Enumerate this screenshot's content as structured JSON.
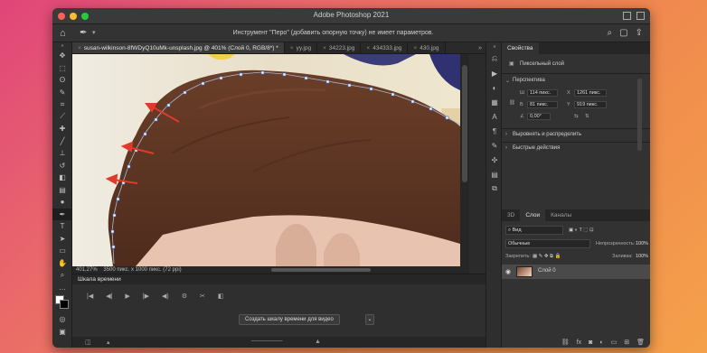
{
  "window": {
    "title": "Adobe Photoshop 2021",
    "traffic_lights": [
      "#ff5f57",
      "#febc2e",
      "#28c840"
    ]
  },
  "options_bar": {
    "hint": "Инструмент \"Перо\" (добавить опорную точку) не имеет параметров.",
    "home_icon": "home-icon",
    "tool_icon": "pen-tool-icon"
  },
  "doc_tabs": [
    {
      "label": "susan-wilkinson-8fWDyQ10uMk-unsplash.jpg @ 401% (Слой 0, RGB/8*) *",
      "active": true
    },
    {
      "label": "yy.jpg",
      "active": false
    },
    {
      "label": "34223.jpg",
      "active": false
    },
    {
      "label": "434333.jpg",
      "active": false
    },
    {
      "label": "430.jpg",
      "active": false
    }
  ],
  "tabs_more": "»",
  "status": {
    "zoom": "401,27%",
    "info": "3500 пикс. x 1000 пикс. (72 ppi)"
  },
  "properties": {
    "tab_label": "Свойства",
    "layer_type": "Пиксельный слой",
    "transform_title": "Перспектива",
    "w_label": "Ш",
    "w_value": "114 пикс.",
    "h_label": "В",
    "h_value": "81 пикс.",
    "x_label": "X",
    "x_value": "1261 пикс.",
    "y_label": "Y",
    "y_value": "919 пикс.",
    "angle_value": "0,00°",
    "align_title": "Выровнять и распределить",
    "quick_title": "Быстрые действия"
  },
  "layers": {
    "tabs": [
      "3D",
      "Слои",
      "Каналы"
    ],
    "active_tab": "Слои",
    "filter_label": "Вид",
    "blend_mode": "Обычные",
    "opacity_label": "Непрозрачность:",
    "opacity_value": "100%",
    "lock_label": "Закрепить:",
    "fill_label": "Заливка:",
    "fill_value": "100%",
    "items": [
      {
        "name": "Слой 0",
        "visible": true
      }
    ]
  },
  "timeline": {
    "title": "Шкала времени",
    "create_button": "Создать шкалу времени для видео",
    "dropdown_icon": "chevron-down-icon"
  },
  "canvas": {
    "arrow_color": "#e23a2a",
    "hair_color": "#5a3322",
    "skin_color": "#e8c4b0",
    "background_color": "#eae3d2"
  }
}
